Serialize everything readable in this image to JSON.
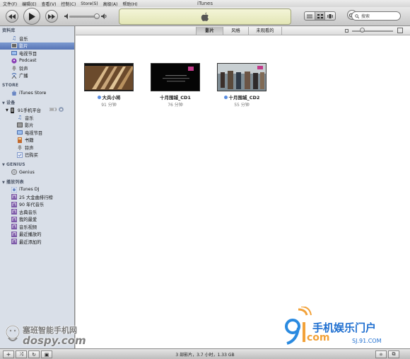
{
  "window": {
    "title": "iTunes"
  },
  "menu": [
    "文件(F)",
    "编辑(E)",
    "查看(V)",
    "控制(C)",
    "Store(S)",
    "高级(A)",
    "帮助(H)"
  ],
  "toolbar": {
    "search_placeholder": "搜索"
  },
  "sidebar": {
    "library_header": "资料库",
    "library": [
      {
        "label": "音乐",
        "icon": "music-note-icon"
      },
      {
        "label": "影片",
        "icon": "film-icon",
        "selected": true
      },
      {
        "label": "电视节目",
        "icon": "tv-icon"
      },
      {
        "label": "Podcast",
        "icon": "podcast-icon"
      },
      {
        "label": "铃声",
        "icon": "bell-icon"
      },
      {
        "label": "广播",
        "icon": "radio-icon"
      }
    ],
    "store_header": "STORE",
    "store": [
      {
        "label": "iTunes Store",
        "icon": "store-icon"
      }
    ],
    "devices_header": "设备",
    "device": {
      "label": "91手机平台",
      "icon": "phone-icon"
    },
    "device_items": [
      {
        "label": "音乐",
        "icon": "music-note-icon"
      },
      {
        "label": "影片",
        "icon": "film-icon"
      },
      {
        "label": "电视节目",
        "icon": "tv-icon"
      },
      {
        "label": "书籍",
        "icon": "book-icon"
      },
      {
        "label": "铃声",
        "icon": "bell-icon"
      },
      {
        "label": "已购买",
        "icon": "purchased-icon"
      }
    ],
    "genius_header": "GENIUS",
    "genius": [
      {
        "label": "Genius",
        "icon": "genius-icon"
      }
    ],
    "playlists_header": "播放列表",
    "playlists": [
      {
        "label": "iTunes DJ",
        "icon": "dj-icon"
      },
      {
        "label": "25 大金曲排行榜",
        "icon": "smart-playlist-icon"
      },
      {
        "label": "90 年代音乐",
        "icon": "smart-playlist-icon"
      },
      {
        "label": "古典音乐",
        "icon": "smart-playlist-icon"
      },
      {
        "label": "我的最爱",
        "icon": "smart-playlist-icon"
      },
      {
        "label": "音乐视频",
        "icon": "smart-playlist-icon"
      },
      {
        "label": "最近播放的",
        "icon": "smart-playlist-icon"
      },
      {
        "label": "最近添加的",
        "icon": "smart-playlist-icon"
      }
    ]
  },
  "tabs": [
    {
      "label": "影片",
      "active": true
    },
    {
      "label": "风格",
      "active": false
    },
    {
      "label": "未观看的",
      "active": false
    }
  ],
  "movies": [
    {
      "title": "大兵小将",
      "duration": "91 分钟"
    },
    {
      "title": "十月围城_CD1",
      "duration": "76 分钟"
    },
    {
      "title": "十月围城_CD2",
      "duration": "55 分钟"
    }
  ],
  "status": {
    "text": "3 部影片，3.7 小时，1.33 GB"
  },
  "watermarks": {
    "left_text": "塞班智能手机网",
    "left_logo": "dospy.com",
    "right_text": "手机娱乐门户",
    "right_url": "SJ.91.COM",
    "right_logo": "com"
  },
  "colors": {
    "selection": "#5f7cbd",
    "sidebar_bg": "#d9dfe8",
    "lcd": "#eef0c8"
  }
}
